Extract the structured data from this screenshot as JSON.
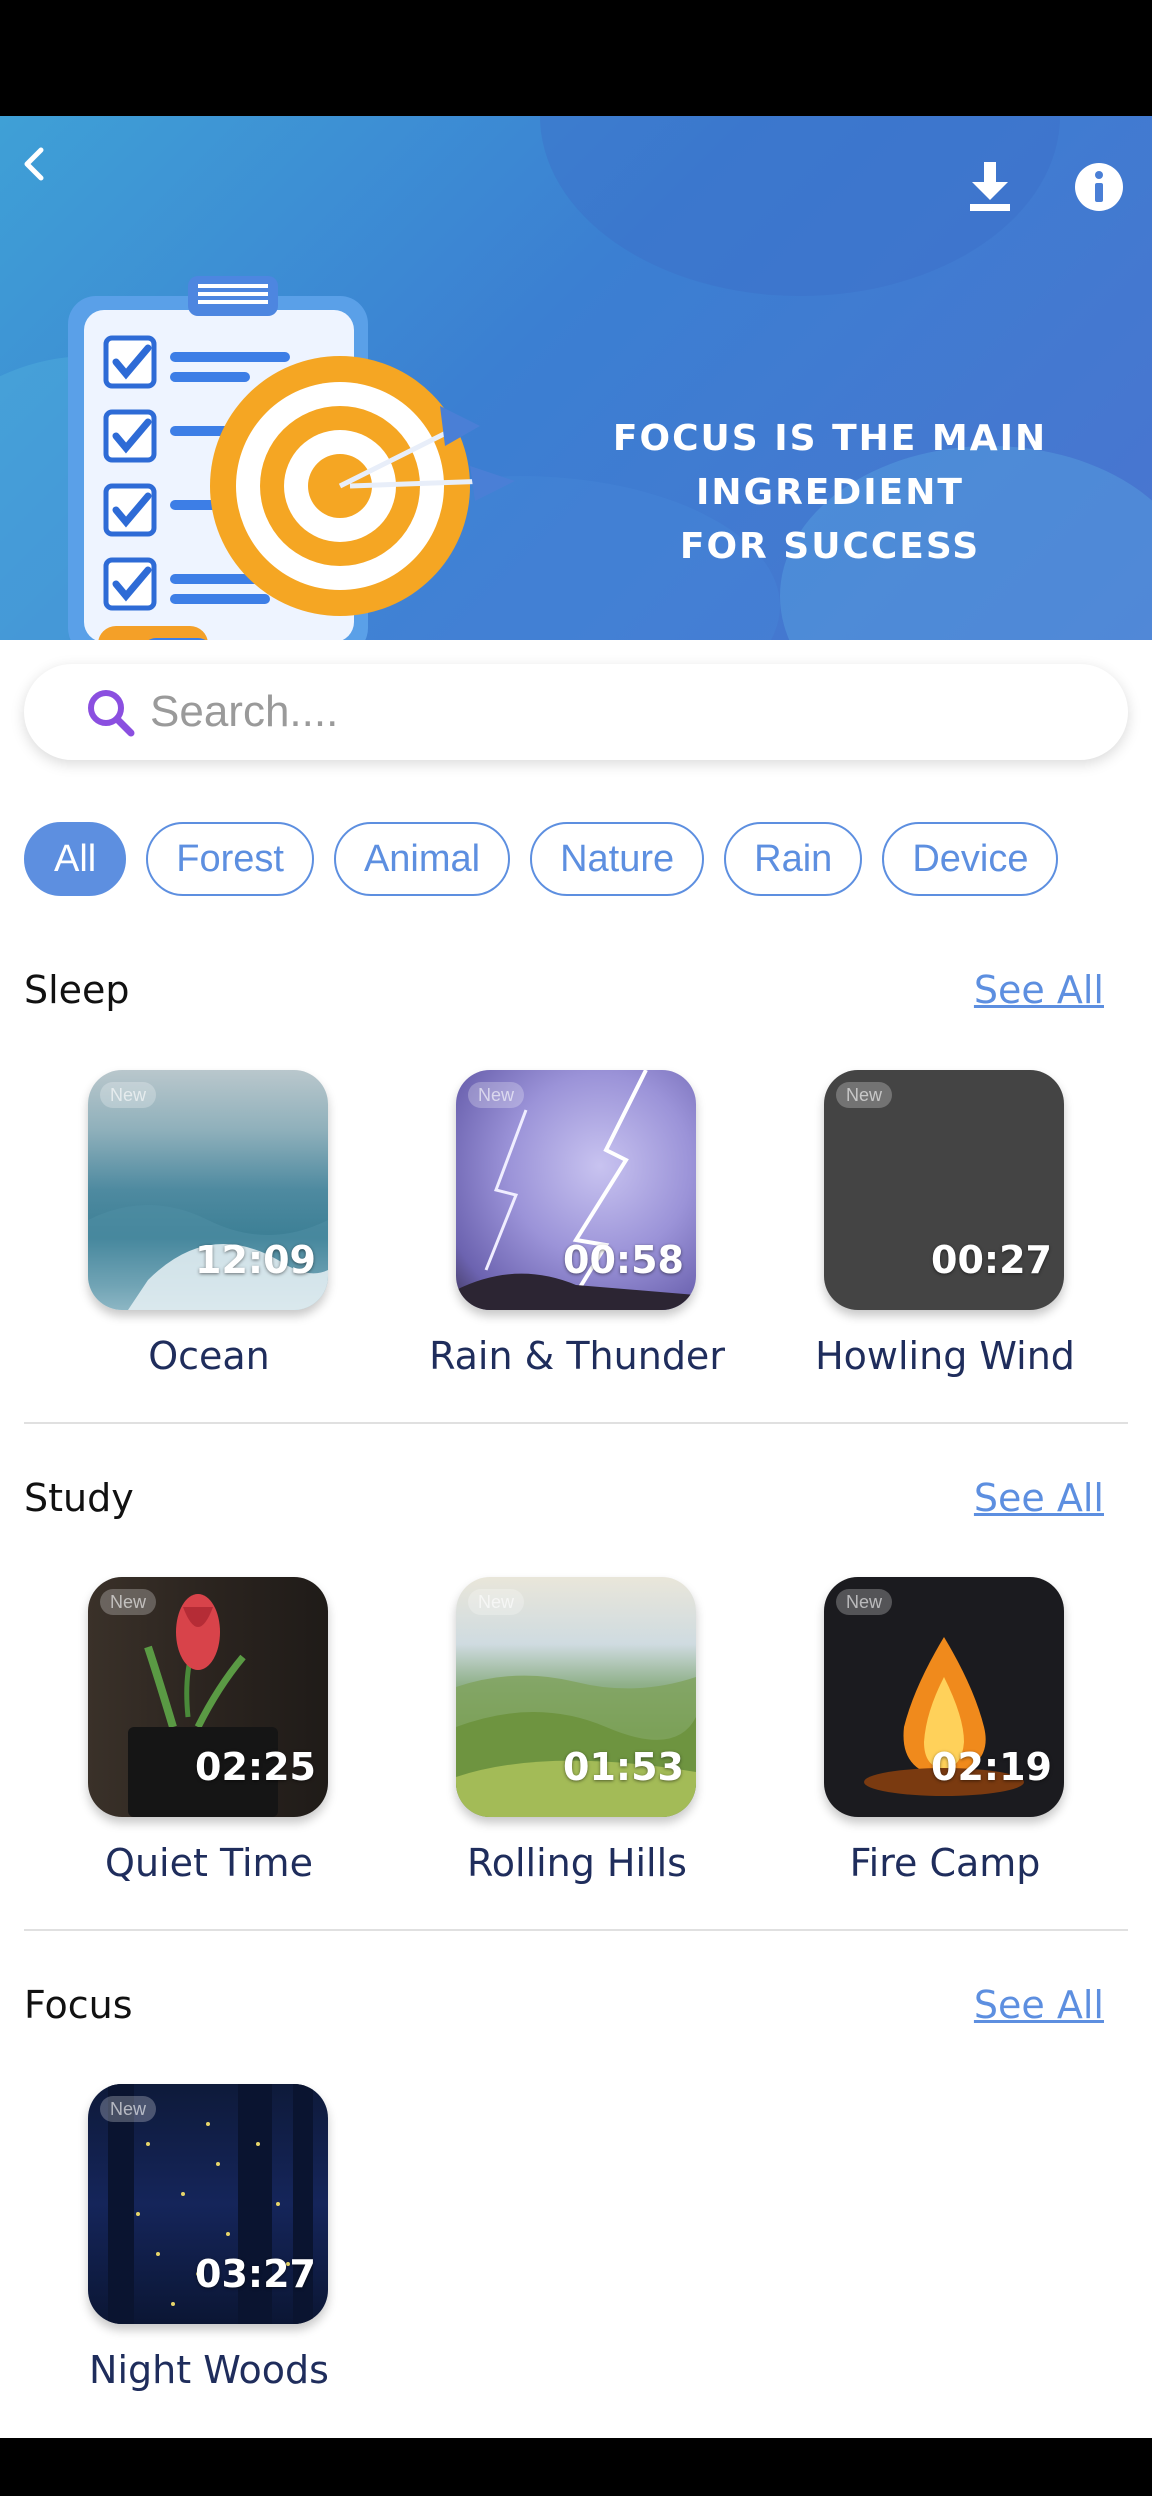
{
  "banner": {
    "headline_lines": [
      "FOCUS IS THE MAIN",
      "INGREDIENT",
      "FOR SUCCESS"
    ],
    "icons": {
      "back": "chevron-left-icon",
      "download": "download-icon",
      "info": "info-icon"
    }
  },
  "search": {
    "placeholder": "Search....",
    "value": ""
  },
  "filters": [
    {
      "label": "All",
      "active": true
    },
    {
      "label": "Forest",
      "active": false
    },
    {
      "label": "Animal",
      "active": false
    },
    {
      "label": "Nature",
      "active": false
    },
    {
      "label": "Rain",
      "active": false
    },
    {
      "label": "Device",
      "active": false
    }
  ],
  "sections": {
    "sleep": {
      "title": "Sleep",
      "see_all": "See All",
      "items": [
        {
          "title": "Ocean",
          "duration": "12:09",
          "badge": "New"
        },
        {
          "title": "Rain & Thunder",
          "duration": "00:58",
          "badge": "New"
        },
        {
          "title": "Howling Wind",
          "duration": "00:27",
          "badge": "New"
        }
      ]
    },
    "study": {
      "title": "Study",
      "see_all": "See All",
      "items": [
        {
          "title": "Quiet Time",
          "duration": "02:25",
          "badge": "New"
        },
        {
          "title": "Rolling Hills",
          "duration": "01:53",
          "badge": "New"
        },
        {
          "title": "Fire Camp",
          "duration": "02:19",
          "badge": "New"
        }
      ]
    },
    "focus": {
      "title": "Focus",
      "see_all": "See All",
      "items": [
        {
          "title": "Night Woods",
          "duration": "03:27",
          "badge": "New"
        }
      ]
    }
  },
  "colors": {
    "accent": "#5d8fe0",
    "title": "#1f2d5c",
    "banner": "#3b7fd2"
  }
}
